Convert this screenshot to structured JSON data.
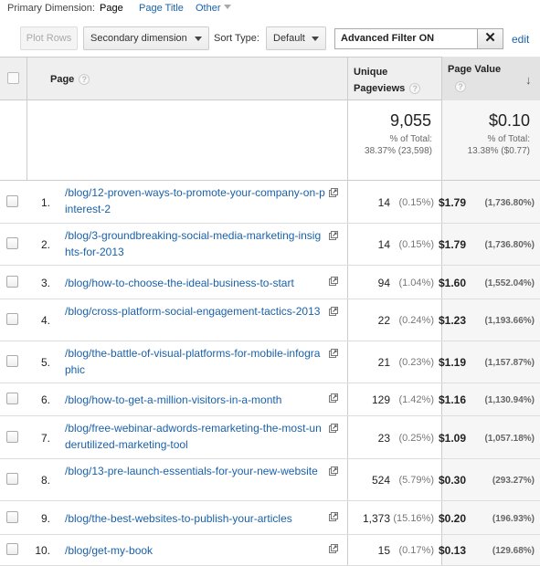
{
  "primary_dimension": {
    "label": "Primary Dimension:",
    "options": [
      "Page",
      "Page Title",
      "Other"
    ],
    "selected": "Page"
  },
  "toolbar": {
    "plot_rows": "Plot Rows",
    "secondary_dimension": "Secondary dimension",
    "sort_type_label": "Sort Type:",
    "sort_type_value": "Default",
    "filter_text": "Advanced Filter ON",
    "clear": "✕",
    "edit": "edit"
  },
  "table": {
    "columns": {
      "page": "Page",
      "unique_pageviews_line1": "Unique",
      "unique_pageviews_line2": "Pageviews",
      "page_value": "Page Value"
    },
    "help": "?",
    "sort_arrow": "↓",
    "totals": {
      "unique_pageviews": "9,055",
      "unique_pageviews_sub1": "% of Total:",
      "unique_pageviews_sub2": "38.37% (23,598)",
      "page_value": "$0.10",
      "page_value_sub1": "% of Total:",
      "page_value_sub2": "13.38% ($0.77)"
    },
    "rows": [
      {
        "num": "1.",
        "page": "/blog/12-proven-ways-to-promote-your-company-on-pinterest-2",
        "upv": "14",
        "upv_pct": "(0.15%)",
        "pv": "$1.79",
        "pv_pct": "(1,736.80%)"
      },
      {
        "num": "2.",
        "page": "/blog/3-groundbreaking-social-media-marketing-insights-for-2013",
        "upv": "14",
        "upv_pct": "(0.15%)",
        "pv": "$1.79",
        "pv_pct": "(1,736.80%)"
      },
      {
        "num": "3.",
        "page": "/blog/how-to-choose-the-ideal-business-to-start",
        "upv": "94",
        "upv_pct": "(1.04%)",
        "pv": "$1.60",
        "pv_pct": "(1,552.04%)"
      },
      {
        "num": "4.",
        "page": "/blog/cross-platform-social-engagement-tactics-2013",
        "upv": "22",
        "upv_pct": "(0.24%)",
        "pv": "$1.23",
        "pv_pct": "(1,193.66%)"
      },
      {
        "num": "5.",
        "page": "/blog/the-battle-of-visual-platforms-for-mobile-infographic",
        "upv": "21",
        "upv_pct": "(0.23%)",
        "pv": "$1.19",
        "pv_pct": "(1,157.87%)"
      },
      {
        "num": "6.",
        "page": "/blog/how-to-get-a-million-visitors-in-a-month",
        "upv": "129",
        "upv_pct": "(1.42%)",
        "pv": "$1.16",
        "pv_pct": "(1,130.94%)"
      },
      {
        "num": "7.",
        "page": "/blog/free-webinar-adwords-remarketing-the-most-underutilized-marketing-tool",
        "upv": "23",
        "upv_pct": "(0.25%)",
        "pv": "$1.09",
        "pv_pct": "(1,057.18%)"
      },
      {
        "num": "8.",
        "page": "/blog/13-pre-launch-essentials-for-your-new-website",
        "upv": "524",
        "upv_pct": "(5.79%)",
        "pv": "$0.30",
        "pv_pct": "(293.27%)"
      },
      {
        "num": "9.",
        "page": "/blog/the-best-websites-to-publish-your-articles",
        "upv": "1,373",
        "upv_pct": "(15.16%)",
        "pv": "$0.20",
        "pv_pct": "(196.93%)"
      },
      {
        "num": "10.",
        "page": "/blog/get-my-book",
        "upv": "15",
        "upv_pct": "(0.17%)",
        "pv": "$0.13",
        "pv_pct": "(129.68%)"
      }
    ]
  }
}
